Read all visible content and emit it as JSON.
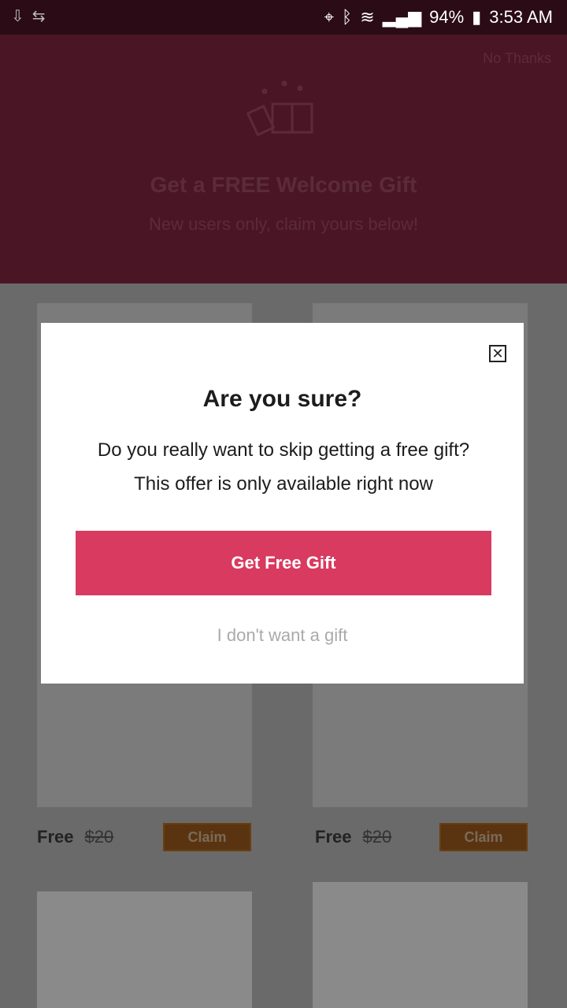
{
  "status": {
    "battery": "94%",
    "time": "3:53 AM"
  },
  "header": {
    "no_thanks": "No Thanks",
    "title": "Get a FREE Welcome Gift",
    "subtitle": "New users only, claim yours below!"
  },
  "products": [
    {
      "free": "Free",
      "price": "$20",
      "claim": "Claim"
    },
    {
      "free": "Free",
      "price": "$20",
      "claim": "Claim"
    }
  ],
  "modal": {
    "title": "Are you sure?",
    "body": "Do you really want to skip getting a free gift? This offer is only available right now",
    "cta": "Get Free Gift",
    "decline": "I don't want a gift"
  },
  "icons": {
    "close": "close-icon",
    "gift": "gift-icon"
  },
  "colors": {
    "accent": "#d93a60",
    "claim_button": "#5a3410",
    "header_bg": "#4a1626"
  }
}
